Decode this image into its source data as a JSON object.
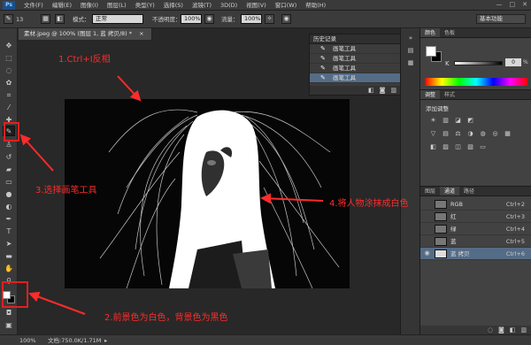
{
  "app": {
    "logo": "Ps",
    "menu": [
      "文件(F)",
      "编辑(E)",
      "图像(I)",
      "图层(L)",
      "类型(Y)",
      "选择(S)",
      "滤镜(T)",
      "3D(D)",
      "视图(V)",
      "窗口(W)",
      "帮助(H)"
    ],
    "window_controls": [
      "—",
      "□",
      "✕"
    ]
  },
  "options": {
    "brush_size": "13",
    "mode_label": "模式：",
    "mode_value": "正常",
    "opacity_label": "不透明度：",
    "opacity_value": "100%",
    "flow_label": "流量：",
    "flow_value": "100%",
    "workspace": "基本功能"
  },
  "document": {
    "tab_title": "素材.jpeg @ 100% (图层 1, 蓝 拷贝/8) *",
    "close": "×"
  },
  "history": {
    "title": "历史记录",
    "items": [
      "画笔工具",
      "画笔工具",
      "画笔工具",
      "画笔工具"
    ],
    "selected_index": 3
  },
  "color_panel": {
    "tabs": [
      "颜色",
      "色板"
    ],
    "k_label": "K",
    "k_value": "0",
    "k_unit": "%"
  },
  "adjustments": {
    "tabs": [
      "调整",
      "样式"
    ],
    "title": "添加调整"
  },
  "channels": {
    "tabs": [
      "图层",
      "通道",
      "路径"
    ],
    "rows": [
      {
        "name": "RGB",
        "shortcut": "Ctrl+2"
      },
      {
        "name": "红",
        "shortcut": "Ctrl+3"
      },
      {
        "name": "绿",
        "shortcut": "Ctrl+4"
      },
      {
        "name": "蓝",
        "shortcut": "Ctrl+5"
      },
      {
        "name": "蓝 拷贝",
        "shortcut": "Ctrl+6"
      }
    ],
    "selected_index": 4
  },
  "statusbar": {
    "zoom": "100%",
    "doc_info": "文档:750.0K/1.71M"
  },
  "annotations": {
    "step1": "1.Ctrl+I反相",
    "step2": "2.前景色为白色，背景色为黑色",
    "step3": "3.选择画笔工具",
    "step4": "4.将人物涂抹成白色",
    "color": "#ff2b2b"
  }
}
